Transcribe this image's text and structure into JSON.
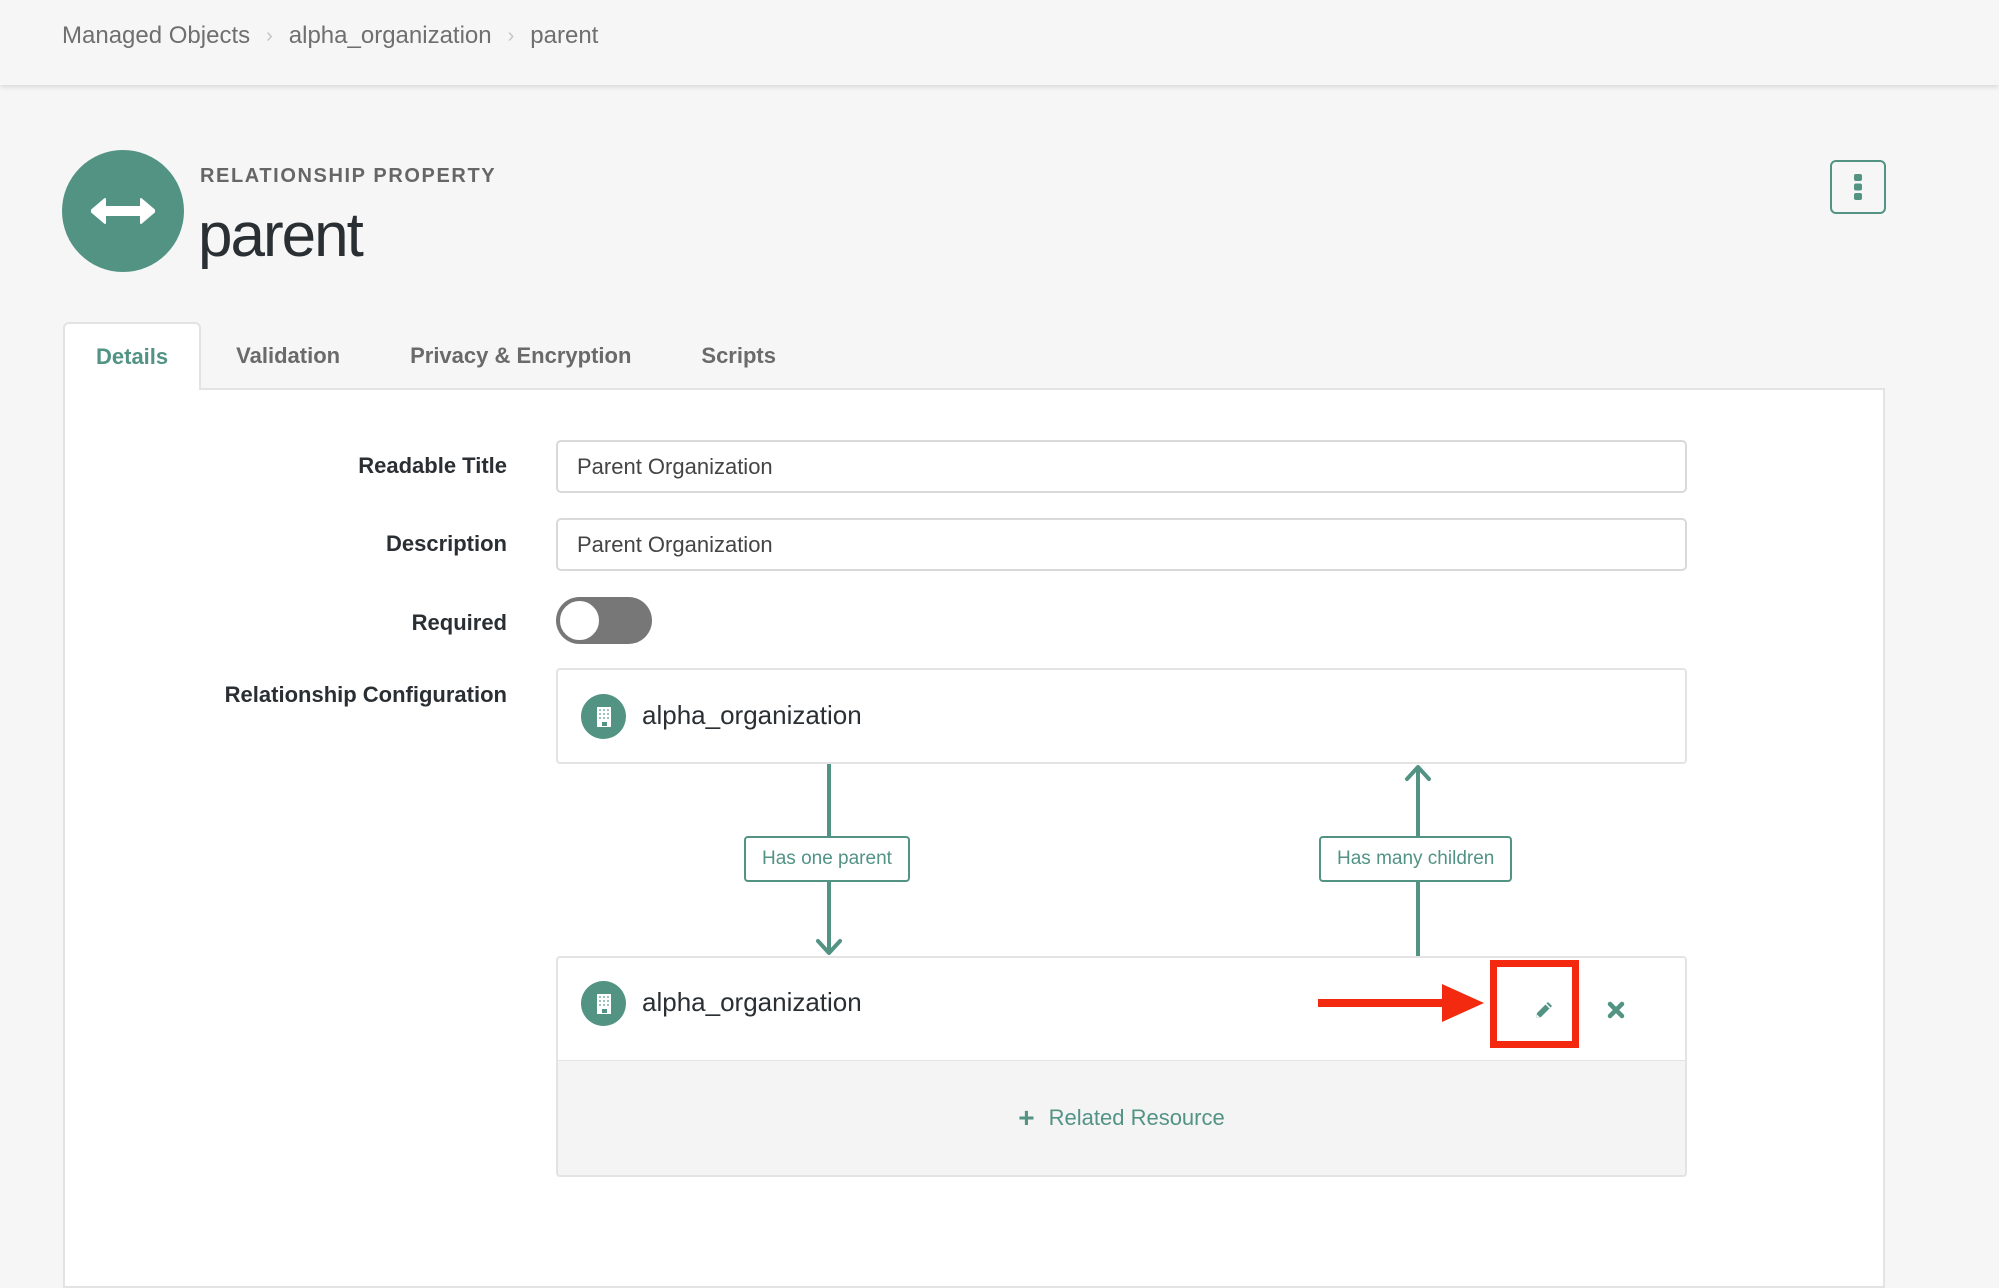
{
  "breadcrumb": {
    "items": [
      "Managed Objects",
      "alpha_organization",
      "parent"
    ],
    "separator": "›"
  },
  "hero": {
    "icon": "double-arrow-icon",
    "kicker": "RELATIONSHIP PROPERTY",
    "title": "parent"
  },
  "actions": {
    "more_icon": "kebab-vertical-icon"
  },
  "tabs": [
    {
      "label": "Details",
      "active": true
    },
    {
      "label": "Validation",
      "active": false
    },
    {
      "label": "Privacy & Encryption",
      "active": false
    },
    {
      "label": "Scripts",
      "active": false
    }
  ],
  "form": {
    "readable_title": {
      "label": "Readable Title",
      "value": "Parent Organization"
    },
    "description": {
      "label": "Description",
      "value": "Parent Organization"
    },
    "required": {
      "label": "Required",
      "checked": false
    },
    "relationship": {
      "label": "Relationship Configuration",
      "source": {
        "icon": "building-icon",
        "name": "alpha_organization"
      },
      "forward_label": "Has one parent",
      "reverse_label": "Has many children",
      "target": {
        "icon": "building-icon",
        "name": "alpha_organization",
        "edit_icon": "pencil-icon",
        "remove_icon": "close-icon"
      },
      "add_label": "Related Resource",
      "add_icon": "plus-icon"
    }
  },
  "colors": {
    "accent": "#529384",
    "annotation": "#f32a0f"
  }
}
